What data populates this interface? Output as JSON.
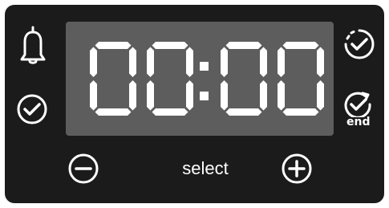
{
  "panel": {
    "background": "#1c1b1b",
    "display_background": "#5e5d5d",
    "foreground": "#ffffff"
  },
  "display": {
    "time": "00:00"
  },
  "buttons": {
    "alarm": {
      "icon": "bell-icon"
    },
    "timer": {
      "icon": "check-clock-icon"
    },
    "duration": {
      "icon": "timer-dashed-check-icon"
    },
    "end_time": {
      "icon": "timer-arrow-check-icon",
      "label": "end"
    },
    "minus": {
      "icon": "minus-circle-icon"
    },
    "plus": {
      "icon": "plus-circle-icon"
    },
    "select": {
      "label": "select"
    }
  }
}
